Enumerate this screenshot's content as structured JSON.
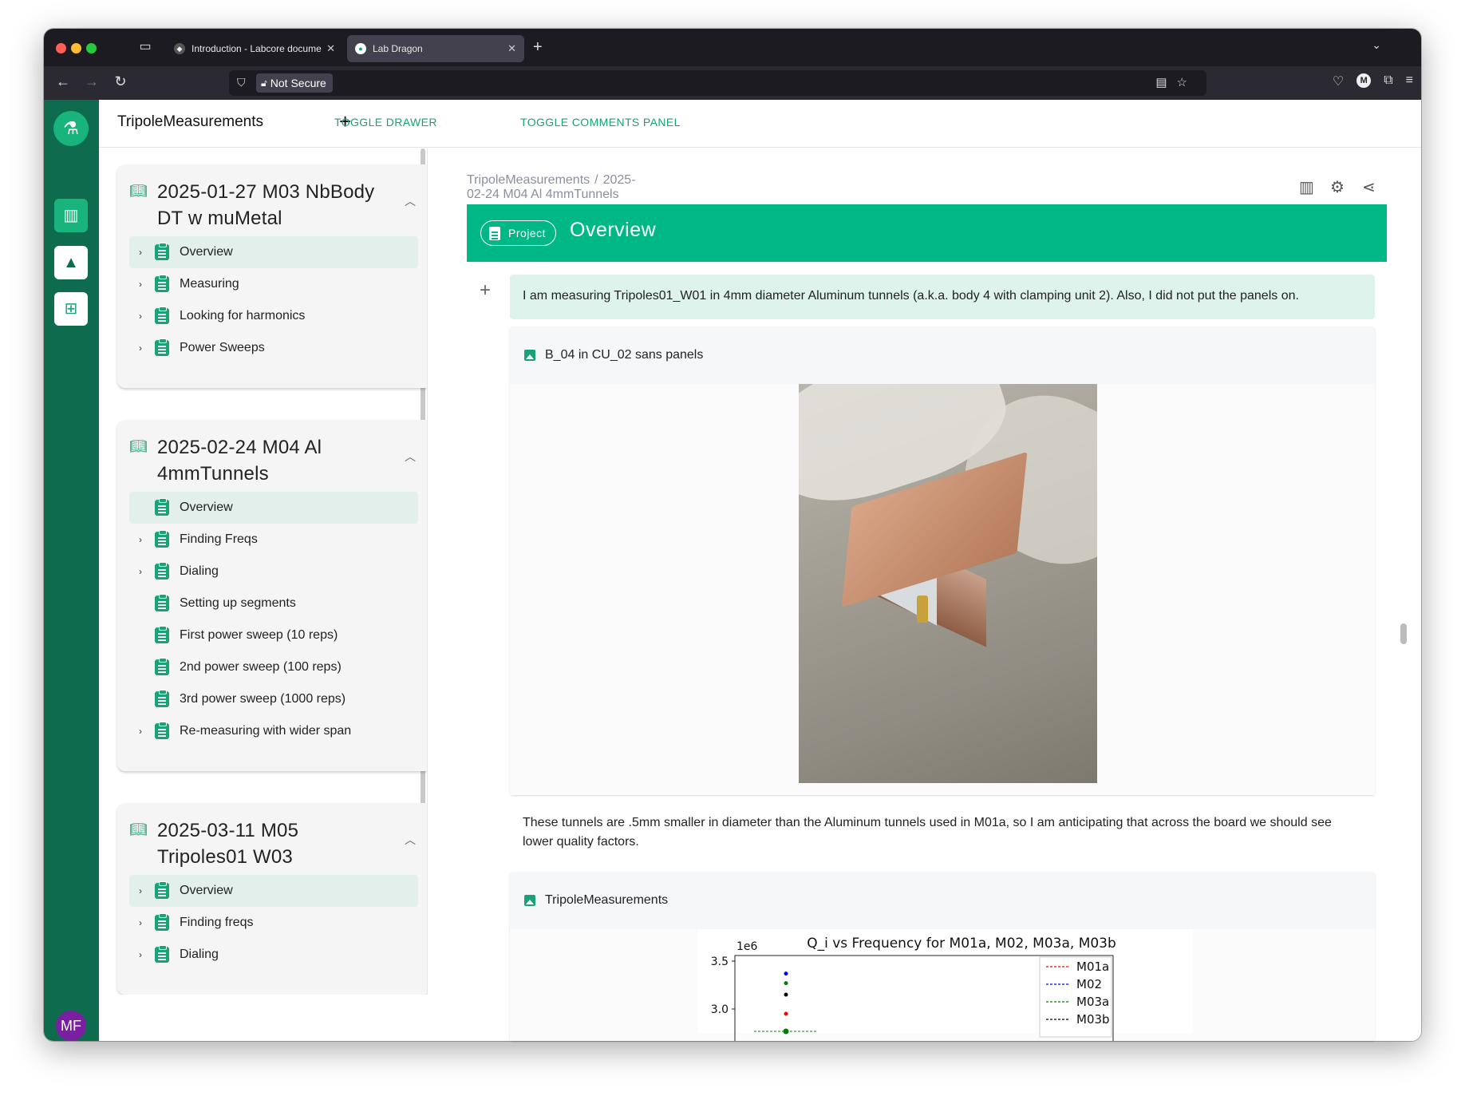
{
  "browser": {
    "tabs": [
      {
        "label": "Introduction - Labcore documen"
      },
      {
        "label": "Lab Dragon"
      }
    ],
    "url_security": "Not Secure"
  },
  "app": {
    "project_title": "TripoleMeasurements",
    "toggle_drawer": "TOGGLE DRAWER",
    "toggle_comments": "TOGGLE COMMENTS PANEL",
    "user_initials": "MF"
  },
  "drawer": {
    "notebooks": [
      {
        "title": "2025-01-27 M03 NbBody DT w muMetal",
        "items": [
          {
            "label": "Overview",
            "expandable": true,
            "selected": true
          },
          {
            "label": "Measuring",
            "expandable": true,
            "selected": false
          },
          {
            "label": "Looking for harmonics",
            "expandable": true,
            "selected": false
          },
          {
            "label": "Power Sweeps",
            "expandable": true,
            "selected": false
          }
        ]
      },
      {
        "title": "2025-02-24 M04 Al 4mmTunnels",
        "items": [
          {
            "label": "Overview",
            "expandable": false,
            "selected": true
          },
          {
            "label": "Finding Freqs",
            "expandable": true,
            "selected": false
          },
          {
            "label": "Dialing",
            "expandable": true,
            "selected": false
          },
          {
            "label": "Setting up segments",
            "expandable": false,
            "selected": false
          },
          {
            "label": "First power sweep (10 reps)",
            "expandable": false,
            "selected": false
          },
          {
            "label": "2nd power sweep (100 reps)",
            "expandable": false,
            "selected": false
          },
          {
            "label": "3rd power sweep (1000 reps)",
            "expandable": false,
            "selected": false
          },
          {
            "label": "Re-measuring with wider span",
            "expandable": true,
            "selected": false
          }
        ]
      },
      {
        "title": "2025-03-11 M05 Tripoles01 W03",
        "items": [
          {
            "label": "Overview",
            "expandable": true,
            "selected": true
          },
          {
            "label": "Finding freqs",
            "expandable": true,
            "selected": false
          },
          {
            "label": "Dialing",
            "expandable": true,
            "selected": false
          }
        ]
      }
    ]
  },
  "main": {
    "breadcrumb": [
      "TripoleMeasurements",
      "2025-02-24 M04 Al 4mmTunnels"
    ],
    "breadcrumb_sep": "/",
    "header": {
      "badge": "Project",
      "title": "Overview"
    },
    "note1": "I am measuring Tripoles01_W01 in 4mm diameter Aluminum tunnels (a.k.a. body 4 with clamping unit 2). Also, I did not put the panels on.",
    "image1_title": "B_04 in CU_02 sans panels",
    "note2": "These tunnels are .5mm smaller in diameter than the Aluminum tunnels used in M01a, so I am anticipating that across the board we should see lower quality factors.",
    "image2_title": "TripoleMeasurements"
  },
  "chart_data": {
    "type": "scatter",
    "title": "Q_i vs Frequency for M01a, M02, M03a, M03b",
    "y_multiplier": "1e6",
    "ytick_labels": [
      "3.5",
      "3.0"
    ],
    "series": [
      {
        "name": "M01a",
        "color": "#ff0000",
        "style": "dashed",
        "points": [
          [
            0,
            2.95
          ]
        ]
      },
      {
        "name": "M02",
        "color": "#0000ff",
        "style": "dashed",
        "points": [
          [
            0,
            3.37
          ]
        ]
      },
      {
        "name": "M03a",
        "color": "#008000",
        "style": "dashed",
        "points": [
          [
            0,
            3.27
          ]
        ]
      },
      {
        "name": "M03b",
        "color": "#000000",
        "style": "dashed",
        "points": [
          [
            0,
            3.15
          ]
        ]
      }
    ]
  },
  "colors": {
    "accent": "#00b886",
    "rail": "#0e6b4d",
    "selected_item_bg": "#e2efeb",
    "note_bg": "#def3eb"
  }
}
